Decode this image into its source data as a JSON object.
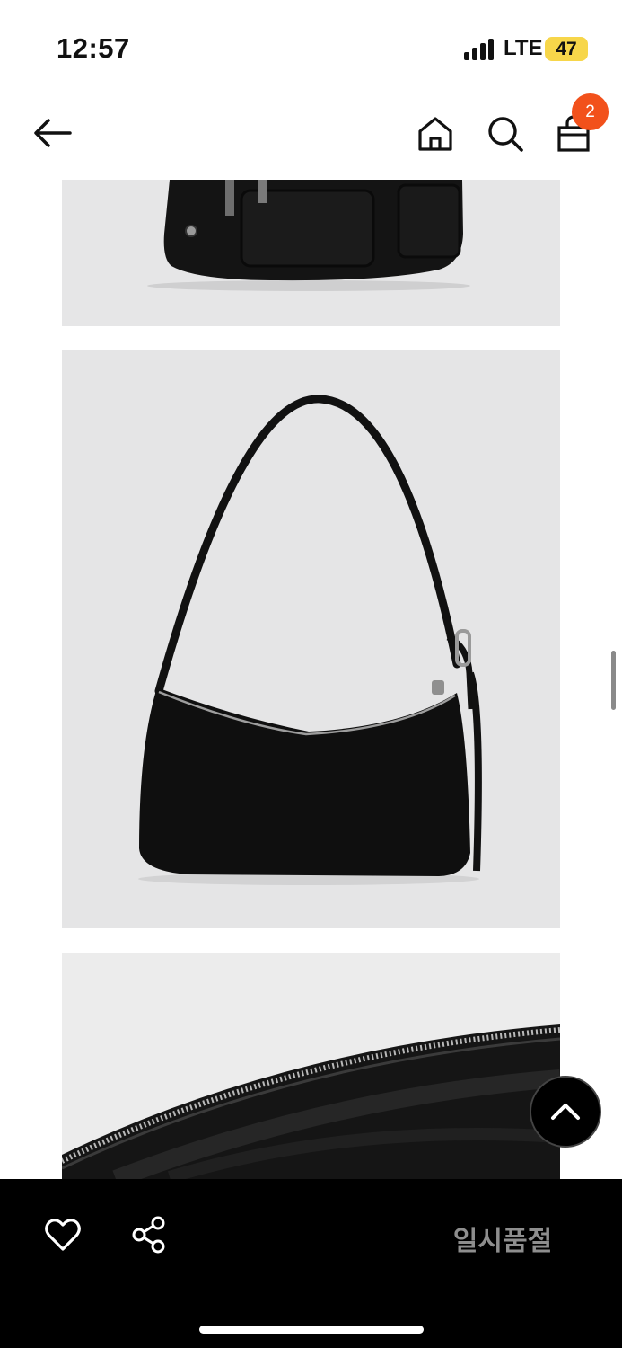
{
  "status": {
    "time": "12:57",
    "network": "LTE",
    "battery": "47"
  },
  "header": {
    "icons": [
      "back-arrow-icon",
      "home-icon",
      "search-icon",
      "shopping-bag-icon"
    ],
    "cart_count": "2"
  },
  "product": {
    "images": [
      "bag-detail-top",
      "shoulder-bag-full",
      "bag-interior-zipper"
    ]
  },
  "bottom_bar": {
    "icons": [
      "heart-icon",
      "share-icon"
    ],
    "status_label": "일시품절"
  },
  "colors": {
    "accent": "#f2511b",
    "bottom_bar": "#000000",
    "sold_out_text": "#8e8e8e",
    "battery": "#f7d64a"
  }
}
